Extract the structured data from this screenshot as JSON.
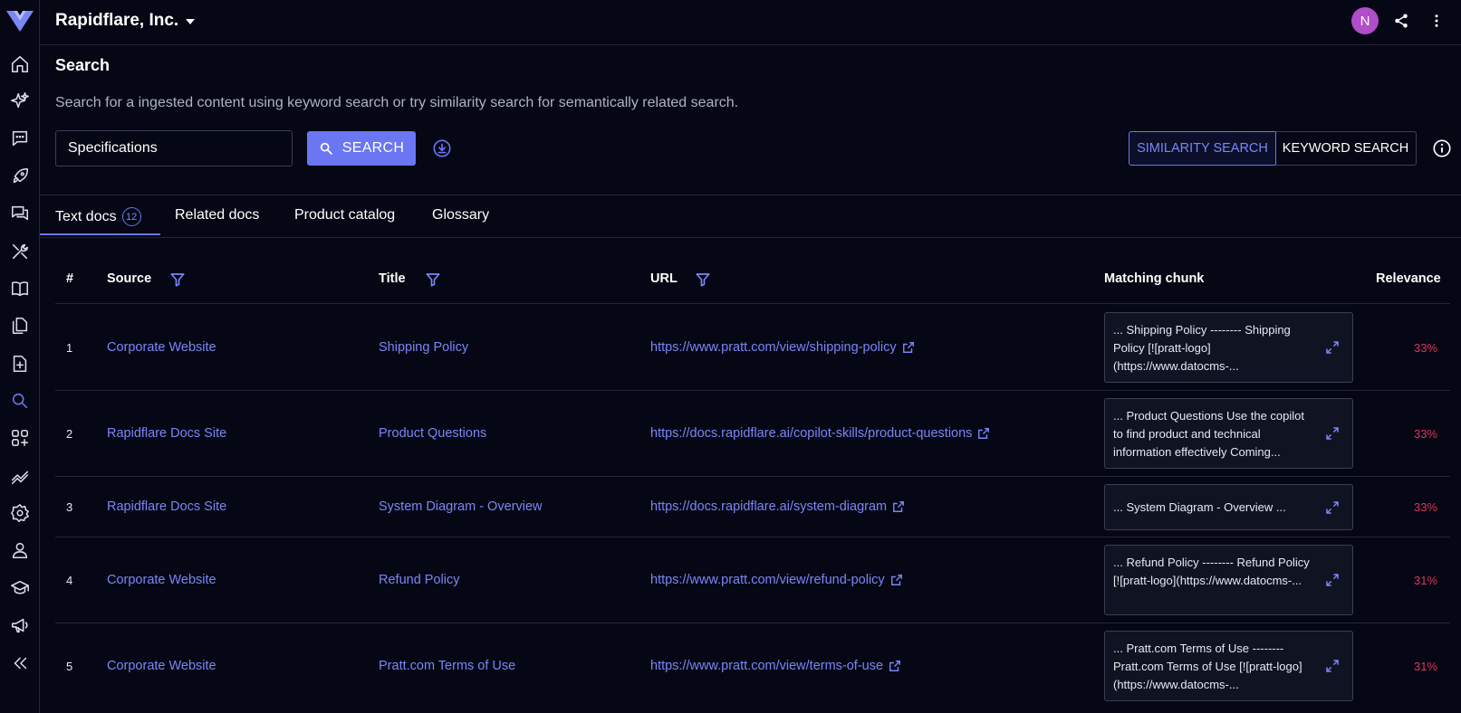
{
  "header": {
    "org_name": "Rapidflare, Inc.",
    "avatar_initial": "N",
    "avatar_color": "#b04dc9"
  },
  "sidebar": {
    "items": [
      {
        "icon": "home-icon"
      },
      {
        "icon": "sparkles-icon"
      },
      {
        "icon": "chat-icon"
      },
      {
        "icon": "rocket-icon"
      },
      {
        "icon": "chats-icon"
      },
      {
        "icon": "tools-icon"
      },
      {
        "icon": "book-icon"
      },
      {
        "icon": "files-icon"
      },
      {
        "icon": "file-add-icon"
      },
      {
        "icon": "search-icon",
        "active": true
      },
      {
        "icon": "apps-add-icon"
      },
      {
        "icon": "analytics-icon"
      },
      {
        "icon": "settings-icon"
      },
      {
        "icon": "user-icon"
      },
      {
        "icon": "graduation-cap-icon"
      },
      {
        "icon": "megaphone-icon"
      },
      {
        "icon": "collapse-icon"
      }
    ]
  },
  "search": {
    "title": "Search",
    "description": "Search for a ingested content using keyword search or try similarity search for semantically related search.",
    "query": "Specifications",
    "button_label": "SEARCH",
    "mode_similarity": "SIMILARITY SEARCH",
    "mode_keyword": "KEYWORD SEARCH",
    "active_mode": "similarity"
  },
  "tabs": [
    {
      "label": "Text docs",
      "badge": "12",
      "active": true
    },
    {
      "label": "Related docs"
    },
    {
      "label": "Product catalog"
    },
    {
      "label": "Glossary"
    }
  ],
  "table": {
    "headers": {
      "num": "#",
      "source": "Source",
      "title": "Title",
      "url": "URL",
      "chunk": "Matching chunk",
      "relevance": "Relevance"
    },
    "rows": [
      {
        "num": "1",
        "source": "Corporate Website",
        "title": "Shipping Policy",
        "url": "https://www.pratt.com/view/shipping-policy",
        "chunk": "... Shipping Policy -------- Shipping Policy [![pratt-logo](https://www.datocms-...",
        "relevance": "33%"
      },
      {
        "num": "2",
        "source": "Rapidflare Docs Site",
        "title": "Product Questions",
        "url": "https://docs.rapidflare.ai/copilot-skills/product-questions",
        "chunk": "... Product Questions Use the copilot to find product and technical information effectively Coming...",
        "relevance": "33%"
      },
      {
        "num": "3",
        "source": "Rapidflare Docs Site",
        "title": "System Diagram - Overview",
        "url": "https://docs.rapidflare.ai/system-diagram",
        "chunk": "... System Diagram - Overview ...",
        "relevance": "33%"
      },
      {
        "num": "4",
        "source": "Corporate Website",
        "title": "Refund Policy",
        "url": "https://www.pratt.com/view/refund-policy",
        "chunk": "... Refund Policy -------- Refund Policy [![pratt-logo](https://www.datocms-...",
        "relevance": "31%"
      },
      {
        "num": "5",
        "source": "Corporate Website",
        "title": "Pratt.com Terms of Use",
        "url": "https://www.pratt.com/view/terms-of-use",
        "chunk": "... Pratt.com Terms of Use -------- Pratt.com Terms of Use [![pratt-logo](https://www.datocms-...",
        "relevance": "31%"
      }
    ]
  },
  "colors": {
    "background": "#050714",
    "accent": "#6a76f2",
    "link": "#7b86f7",
    "relevance": "#e0335a"
  }
}
